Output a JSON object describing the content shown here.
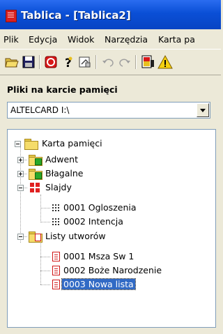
{
  "window": {
    "title": "Tablica - [Tablica2]"
  },
  "menu": [
    "Plik",
    "Edycja",
    "Widok",
    "Narzędzia",
    "Karta pa"
  ],
  "toolbar": {
    "buttons": [
      "open-icon",
      "save-icon",
      "stop-icon",
      "help-icon",
      "properties-icon",
      "undo-icon",
      "redo-icon",
      "slide-icon",
      "warning-icon"
    ]
  },
  "panel": {
    "title": "Pliki na karcie pamięci"
  },
  "drive_select": {
    "value": "ALTELCARD I:\\"
  },
  "tree": {
    "root": "Karta pamięci",
    "adwent": "Adwent",
    "blagalne": "Błagalne",
    "slajdy": "Slajdy",
    "slajd1": "0001 Ogloszenia",
    "slajd2": "0002 Intencja",
    "listy": "Listy utworów",
    "lista1": "0001 Msza Sw 1",
    "lista2": "0002 Boże Narodzenie",
    "lista3": "0003 Nowa lista"
  },
  "colors": {
    "titlebar": "#0a4fd6",
    "selection": "#316ac5",
    "window_bg": "#ece9d8"
  }
}
